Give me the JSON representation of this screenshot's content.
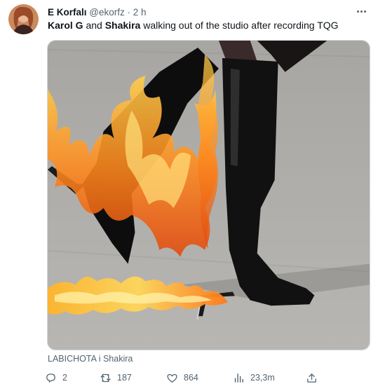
{
  "tweet": {
    "display_name": "E Korfalı",
    "handle": "@ekorfz",
    "separator": "·",
    "time": "2 h",
    "text_part1": "Karol G",
    "text_part2": " and ",
    "text_part3": "Shakira",
    "text_part4": " walking out of the studio after recording TQG"
  },
  "media": {
    "description_icon": "photo-of-black-boot-with-flames"
  },
  "attribution": "LABICHOTA i Shakira",
  "actions": {
    "reply_count": "2",
    "retweet_count": "187",
    "like_count": "864",
    "views_count": "23,3m"
  },
  "colors": {
    "text_primary": "#0f1419",
    "text_secondary": "#536471",
    "border": "#cfd9de"
  }
}
